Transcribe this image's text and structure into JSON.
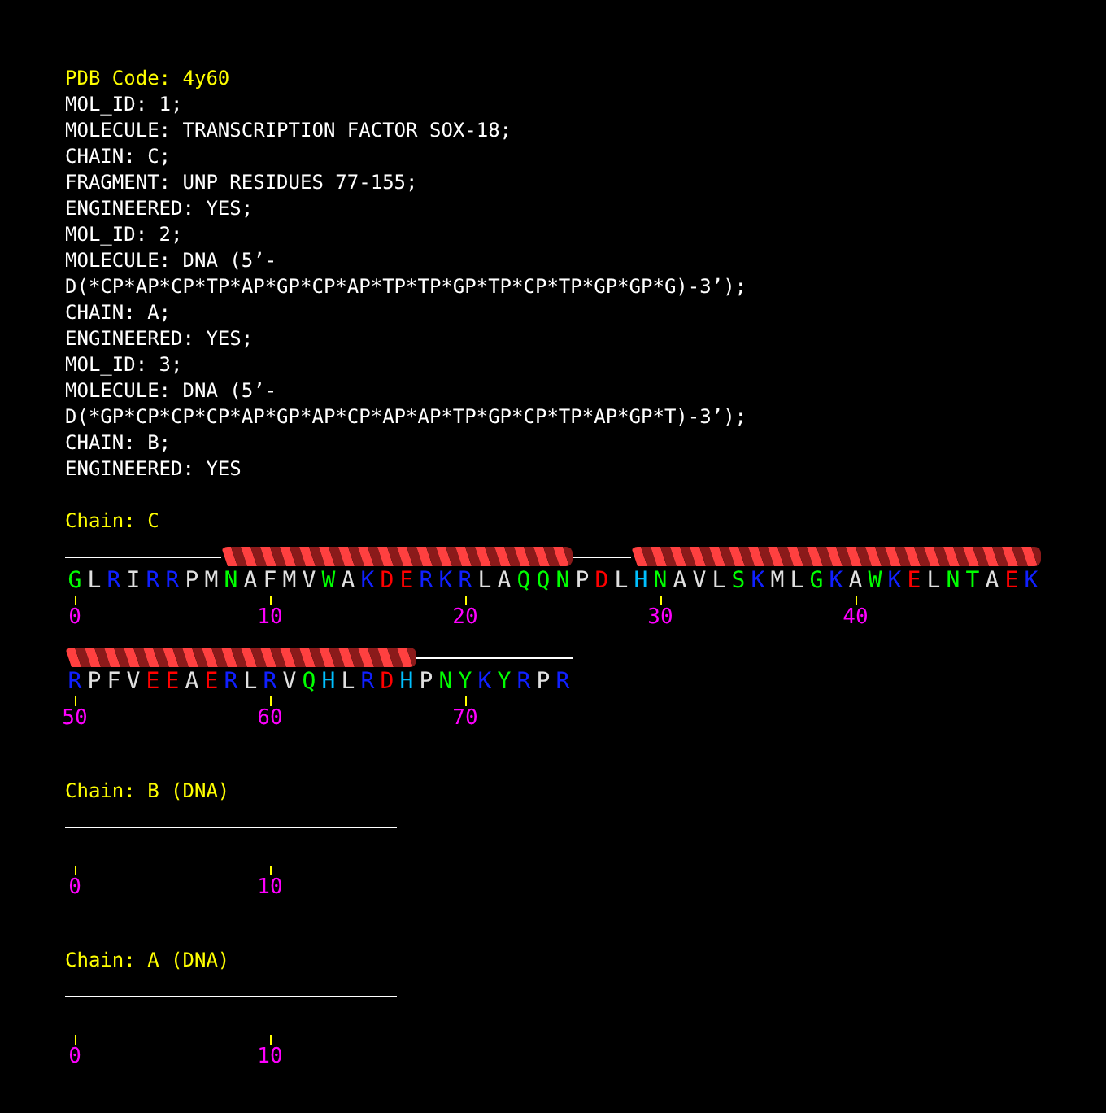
{
  "header": {
    "title": "PDB Code: 4y60",
    "lines": [
      "MOL_ID: 1;",
      "MOLECULE: TRANSCRIPTION FACTOR SOX-18;",
      "CHAIN: C;",
      "FRAGMENT: UNP RESIDUES 77-155;",
      "ENGINEERED: YES;",
      "MOL_ID: 2;",
      "MOLECULE: DNA (5’-",
      "D(*CP*AP*CP*TP*AP*GP*CP*AP*TP*TP*GP*TP*CP*TP*GP*GP*G)-3’);",
      "CHAIN: A;",
      "ENGINEERED: YES;",
      "MOL_ID: 3;",
      "MOLECULE: DNA (5’-",
      "D(*GP*CP*CP*CP*AP*GP*AP*CP*AP*AP*TP*GP*CP*TP*AP*GP*T)-3’);",
      "CHAIN: B;",
      "ENGINEERED: YES"
    ]
  },
  "chains": [
    {
      "label": "Chain: C",
      "rows": [
        [
          {
            "letter": "G",
            "color": "#00ff00",
            "kind": "coil",
            "tick": "0"
          },
          {
            "letter": "L",
            "color": "#e0e0e0",
            "kind": "coil"
          },
          {
            "letter": "R",
            "color": "#1020ff",
            "kind": "coil"
          },
          {
            "letter": "I",
            "color": "#e0e0e0",
            "kind": "coil"
          },
          {
            "letter": "R",
            "color": "#1020ff",
            "kind": "coil"
          },
          {
            "letter": "R",
            "color": "#1020ff",
            "kind": "coil"
          },
          {
            "letter": "P",
            "color": "#e0e0e0",
            "kind": "coil"
          },
          {
            "letter": "M",
            "color": "#e0e0e0",
            "kind": "coil"
          },
          {
            "letter": "N",
            "color": "#00ff00",
            "kind": "helix"
          },
          {
            "letter": "A",
            "color": "#e0e0e0",
            "kind": "helix"
          },
          {
            "letter": "F",
            "color": "#e0e0e0",
            "kind": "helix",
            "tick": "10"
          },
          {
            "letter": "M",
            "color": "#e0e0e0",
            "kind": "helix"
          },
          {
            "letter": "V",
            "color": "#e0e0e0",
            "kind": "helix"
          },
          {
            "letter": "W",
            "color": "#00ff00",
            "kind": "helix"
          },
          {
            "letter": "A",
            "color": "#e0e0e0",
            "kind": "helix"
          },
          {
            "letter": "K",
            "color": "#1020ff",
            "kind": "helix"
          },
          {
            "letter": "D",
            "color": "#ff0000",
            "kind": "helix"
          },
          {
            "letter": "E",
            "color": "#ff0000",
            "kind": "helix"
          },
          {
            "letter": "R",
            "color": "#1020ff",
            "kind": "helix"
          },
          {
            "letter": "K",
            "color": "#1020ff",
            "kind": "helix"
          },
          {
            "letter": "R",
            "color": "#1020ff",
            "kind": "helix",
            "tick": "20"
          },
          {
            "letter": "L",
            "color": "#e0e0e0",
            "kind": "helix"
          },
          {
            "letter": "A",
            "color": "#e0e0e0",
            "kind": "helix"
          },
          {
            "letter": "Q",
            "color": "#00ff00",
            "kind": "helix"
          },
          {
            "letter": "Q",
            "color": "#00ff00",
            "kind": "helix"
          },
          {
            "letter": "N",
            "color": "#00ff00",
            "kind": "helix"
          },
          {
            "letter": "P",
            "color": "#e0e0e0",
            "kind": "coil"
          },
          {
            "letter": "D",
            "color": "#ff0000",
            "kind": "coil"
          },
          {
            "letter": "L",
            "color": "#e0e0e0",
            "kind": "coil"
          },
          {
            "letter": "H",
            "color": "#00c0ff",
            "kind": "helix"
          },
          {
            "letter": "N",
            "color": "#00ff00",
            "kind": "helix",
            "tick": "30"
          },
          {
            "letter": "A",
            "color": "#e0e0e0",
            "kind": "helix"
          },
          {
            "letter": "V",
            "color": "#e0e0e0",
            "kind": "helix"
          },
          {
            "letter": "L",
            "color": "#e0e0e0",
            "kind": "helix"
          },
          {
            "letter": "S",
            "color": "#00ff00",
            "kind": "helix"
          },
          {
            "letter": "K",
            "color": "#1020ff",
            "kind": "helix"
          },
          {
            "letter": "M",
            "color": "#e0e0e0",
            "kind": "helix"
          },
          {
            "letter": "L",
            "color": "#e0e0e0",
            "kind": "helix"
          },
          {
            "letter": "G",
            "color": "#00ff00",
            "kind": "helix"
          },
          {
            "letter": "K",
            "color": "#1020ff",
            "kind": "helix"
          },
          {
            "letter": "A",
            "color": "#e0e0e0",
            "kind": "helix",
            "tick": "40"
          },
          {
            "letter": "W",
            "color": "#00ff00",
            "kind": "helix"
          },
          {
            "letter": "K",
            "color": "#1020ff",
            "kind": "helix"
          },
          {
            "letter": "E",
            "color": "#ff0000",
            "kind": "helix"
          },
          {
            "letter": "L",
            "color": "#e0e0e0",
            "kind": "helix"
          },
          {
            "letter": "N",
            "color": "#00ff00",
            "kind": "helix"
          },
          {
            "letter": "T",
            "color": "#00ff00",
            "kind": "helix"
          },
          {
            "letter": "A",
            "color": "#e0e0e0",
            "kind": "helix"
          },
          {
            "letter": "E",
            "color": "#ff0000",
            "kind": "helix"
          },
          {
            "letter": "K",
            "color": "#1020ff",
            "kind": "helix"
          }
        ],
        [
          {
            "letter": "R",
            "color": "#1020ff",
            "kind": "helix",
            "tick": "50"
          },
          {
            "letter": "P",
            "color": "#e0e0e0",
            "kind": "helix"
          },
          {
            "letter": "F",
            "color": "#e0e0e0",
            "kind": "helix"
          },
          {
            "letter": "V",
            "color": "#e0e0e0",
            "kind": "helix"
          },
          {
            "letter": "E",
            "color": "#ff0000",
            "kind": "helix"
          },
          {
            "letter": "E",
            "color": "#ff0000",
            "kind": "helix"
          },
          {
            "letter": "A",
            "color": "#e0e0e0",
            "kind": "helix"
          },
          {
            "letter": "E",
            "color": "#ff0000",
            "kind": "helix"
          },
          {
            "letter": "R",
            "color": "#1020ff",
            "kind": "helix"
          },
          {
            "letter": "L",
            "color": "#e0e0e0",
            "kind": "helix"
          },
          {
            "letter": "R",
            "color": "#1020ff",
            "kind": "helix",
            "tick": "60"
          },
          {
            "letter": "V",
            "color": "#e0e0e0",
            "kind": "helix"
          },
          {
            "letter": "Q",
            "color": "#00ff00",
            "kind": "helix"
          },
          {
            "letter": "H",
            "color": "#00c0ff",
            "kind": "helix"
          },
          {
            "letter": "L",
            "color": "#e0e0e0",
            "kind": "helix"
          },
          {
            "letter": "R",
            "color": "#1020ff",
            "kind": "helix"
          },
          {
            "letter": "D",
            "color": "#ff0000",
            "kind": "helix"
          },
          {
            "letter": "H",
            "color": "#00c0ff",
            "kind": "helix"
          },
          {
            "letter": "P",
            "color": "#e0e0e0",
            "kind": "coil"
          },
          {
            "letter": "N",
            "color": "#00ff00",
            "kind": "coil"
          },
          {
            "letter": "Y",
            "color": "#00ff00",
            "kind": "coil",
            "tick": "70"
          },
          {
            "letter": "K",
            "color": "#1020ff",
            "kind": "coil"
          },
          {
            "letter": "Y",
            "color": "#00ff00",
            "kind": "coil"
          },
          {
            "letter": "R",
            "color": "#1020ff",
            "kind": "coil"
          },
          {
            "letter": "P",
            "color": "#e0e0e0",
            "kind": "coil"
          },
          {
            "letter": "R",
            "color": "#1020ff",
            "kind": "coil"
          }
        ]
      ]
    },
    {
      "label": "Chain: B (DNA)",
      "rows": [
        [
          {
            "kind": "coil",
            "tick": "0"
          },
          {
            "kind": "coil"
          },
          {
            "kind": "coil"
          },
          {
            "kind": "coil"
          },
          {
            "kind": "coil"
          },
          {
            "kind": "coil"
          },
          {
            "kind": "coil"
          },
          {
            "kind": "coil"
          },
          {
            "kind": "coil"
          },
          {
            "kind": "coil"
          },
          {
            "kind": "coil",
            "tick": "10"
          },
          {
            "kind": "coil"
          },
          {
            "kind": "coil"
          },
          {
            "kind": "coil"
          },
          {
            "kind": "coil"
          },
          {
            "kind": "coil"
          },
          {
            "kind": "coil"
          }
        ]
      ]
    },
    {
      "label": "Chain: A (DNA)",
      "rows": [
        [
          {
            "kind": "coil",
            "tick": "0"
          },
          {
            "kind": "coil"
          },
          {
            "kind": "coil"
          },
          {
            "kind": "coil"
          },
          {
            "kind": "coil"
          },
          {
            "kind": "coil"
          },
          {
            "kind": "coil"
          },
          {
            "kind": "coil"
          },
          {
            "kind": "coil"
          },
          {
            "kind": "coil"
          },
          {
            "kind": "coil",
            "tick": "10"
          },
          {
            "kind": "coil"
          },
          {
            "kind": "coil"
          },
          {
            "kind": "coil"
          },
          {
            "kind": "coil"
          },
          {
            "kind": "coil"
          },
          {
            "kind": "coil"
          }
        ]
      ]
    }
  ]
}
